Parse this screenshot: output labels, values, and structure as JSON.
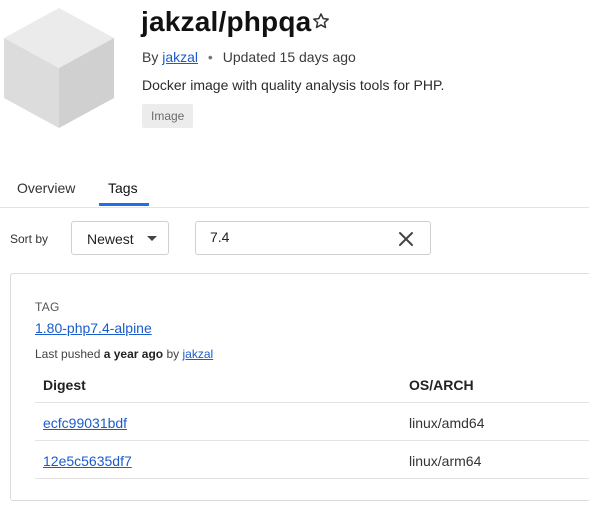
{
  "repo": {
    "title": "jakzal/phpqa",
    "by_label": "By",
    "author": "jakzal",
    "updated": "Updated 15 days ago",
    "description": "Docker image with quality analysis tools for PHP.",
    "badge": "Image"
  },
  "tabs": [
    {
      "label": "Overview",
      "active": false
    },
    {
      "label": "Tags",
      "active": true
    }
  ],
  "sort": {
    "label": "Sort by",
    "value": "Newest"
  },
  "filter": {
    "value": "7.4"
  },
  "tag": {
    "section_label": "TAG",
    "name": "1.80-php7.4-alpine",
    "pushed_prefix": "Last pushed",
    "pushed_when": "a year ago",
    "pushed_by_word": "by",
    "pushed_by": "jakzal",
    "columns": [
      "Digest",
      "OS/ARCH"
    ],
    "rows": [
      {
        "digest": "ecfc99031bdf",
        "os_arch": "linux/amd64"
      },
      {
        "digest": "12e5c5635df7",
        "os_arch": "linux/arm64"
      }
    ]
  },
  "colors": {
    "accent": "#1f6feb",
    "link": "#1a5ccc"
  }
}
